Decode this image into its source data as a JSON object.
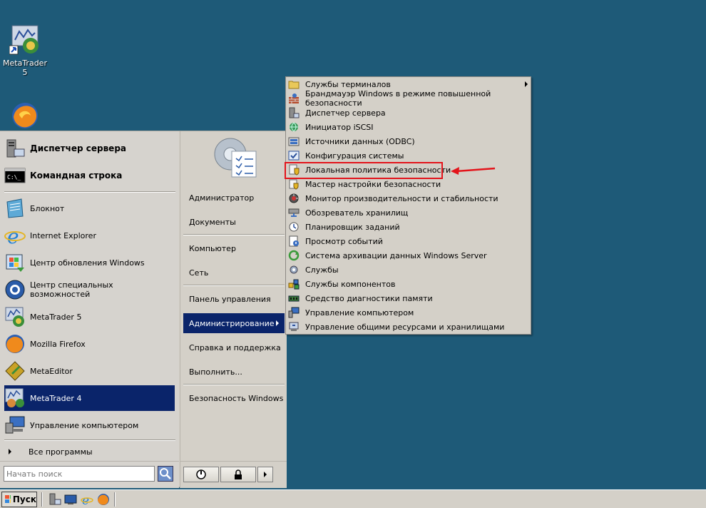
{
  "desktop": {
    "icons": [
      {
        "label": "MetaTrader 5"
      }
    ]
  },
  "start_menu": {
    "pinned": [
      {
        "label": "Диспетчер сервера"
      },
      {
        "label": "Командная строка"
      }
    ],
    "programs": [
      {
        "label": "Блокнот"
      },
      {
        "label": "Internet Explorer"
      },
      {
        "label": "Центр обновления Windows"
      },
      {
        "label": "Центр специальных возможностей"
      },
      {
        "label": "MetaTrader 5"
      },
      {
        "label": "Mozilla Firefox"
      },
      {
        "label": "MetaEditor"
      },
      {
        "label": "MetaTrader 4"
      },
      {
        "label": "Управление компьютером"
      }
    ],
    "all_programs": "Все программы",
    "search_placeholder": "Начать поиск",
    "right": [
      {
        "label": "Администратор"
      },
      {
        "label": "Документы"
      },
      {
        "label": "Компьютер"
      },
      {
        "label": "Сеть"
      },
      {
        "label": "Панель управления"
      },
      {
        "label": "Администрирование"
      },
      {
        "label": "Справка и поддержка"
      },
      {
        "label": "Выполнить..."
      },
      {
        "label": "Безопасность Windows"
      }
    ]
  },
  "admin_submenu": {
    "items": [
      {
        "label": "Службы терминалов"
      },
      {
        "label": "Брандмауэр Windows в режиме повышенной безопасности"
      },
      {
        "label": "Диспетчер сервера"
      },
      {
        "label": "Инициатор iSCSI"
      },
      {
        "label": "Источники данных (ODBC)"
      },
      {
        "label": "Конфигурация системы"
      },
      {
        "label": "Локальная политика безопасности"
      },
      {
        "label": "Мастер настройки безопасности"
      },
      {
        "label": "Монитор производительности и стабильности"
      },
      {
        "label": "Обозреватель хранилищ"
      },
      {
        "label": "Планировщик заданий"
      },
      {
        "label": "Просмотр событий"
      },
      {
        "label": "Система архивации данных Windows Server"
      },
      {
        "label": "Службы"
      },
      {
        "label": "Службы компонентов"
      },
      {
        "label": "Средство диагностики памяти"
      },
      {
        "label": "Управление компьютером"
      },
      {
        "label": "Управление общими ресурсами и хранилищами"
      }
    ]
  },
  "taskbar": {
    "start_label": "Пуск"
  },
  "colors": {
    "desktop": "#1e5a78",
    "selection": "#0a246a",
    "annotation": "#e3141b"
  }
}
